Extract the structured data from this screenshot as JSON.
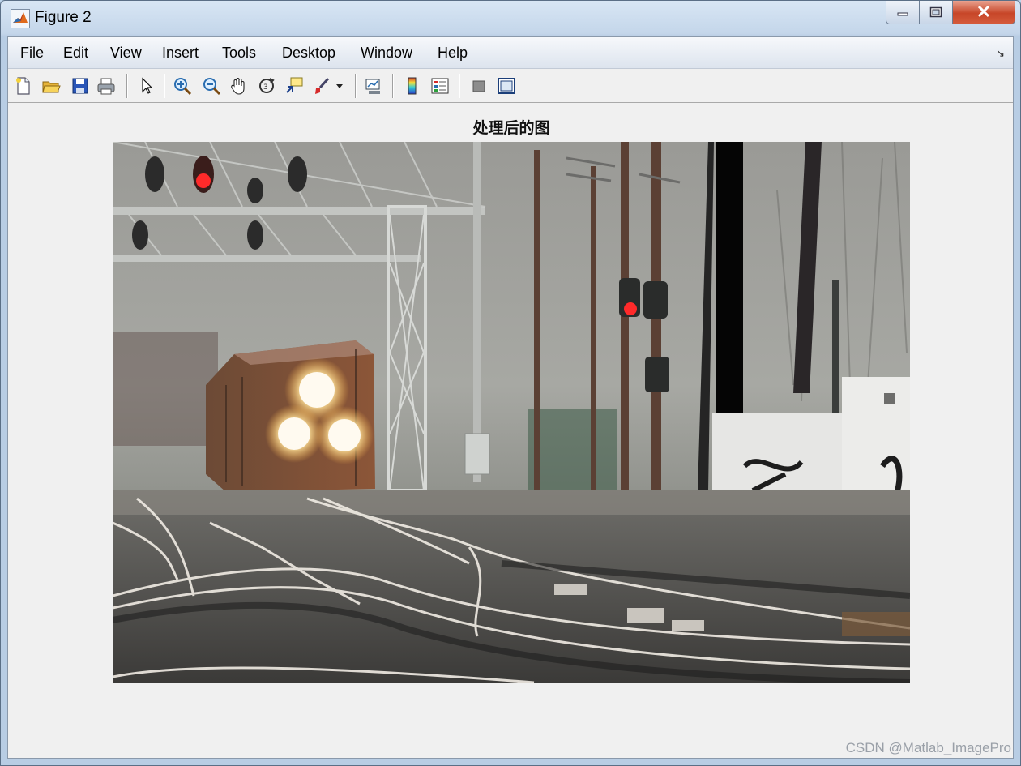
{
  "window": {
    "title": "Figure 2"
  },
  "menu": [
    "File",
    "Edit",
    "View",
    "Insert",
    "Tools",
    "Desktop",
    "Window",
    "Help"
  ],
  "toolbar": {
    "icons": [
      "new-figure-icon",
      "open-file-icon",
      "save-icon",
      "print-icon",
      "edit-plot-icon",
      "zoom-in-icon",
      "zoom-out-icon",
      "pan-icon",
      "rotate-3d-icon",
      "data-cursor-icon",
      "brush-icon",
      "brush-dropdown-icon",
      "link-plot-icon",
      "colorbar-icon",
      "legend-icon",
      "hide-plot-tools-icon",
      "show-plot-tools-icon"
    ]
  },
  "axes": {
    "title": "处理后的图"
  },
  "watermark": "CSDN @Matlab_ImagePro"
}
